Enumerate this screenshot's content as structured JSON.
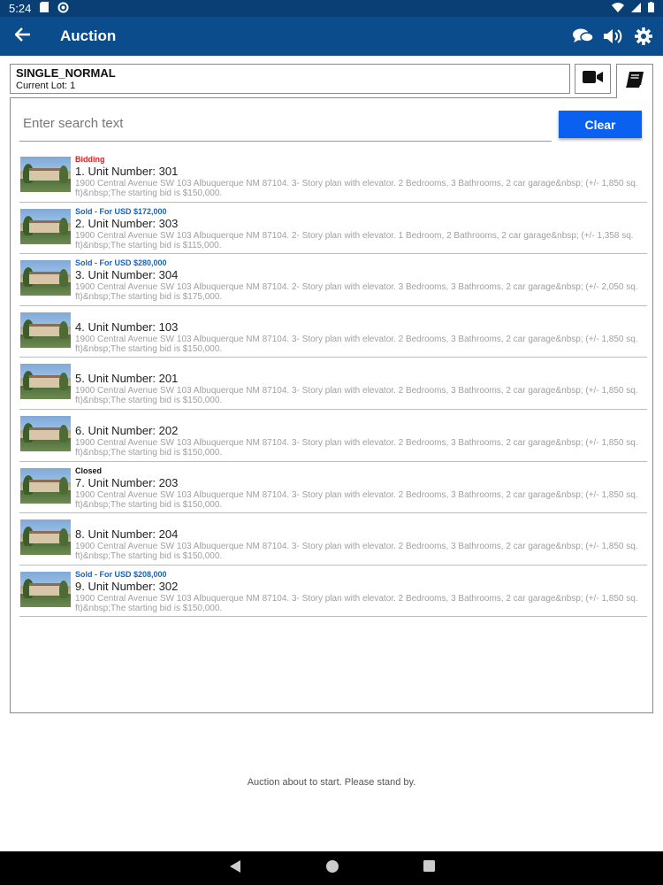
{
  "status_bar": {
    "time": "5:24"
  },
  "appbar": {
    "title": "Auction"
  },
  "lot": {
    "name": "SINGLE_NORMAL",
    "current": "Current Lot: 1"
  },
  "search": {
    "placeholder": "Enter search text",
    "clear_label": "Clear"
  },
  "items": [
    {
      "status": "Bidding",
      "status_color": "#e02020",
      "unit": "1. Unit Number: 301",
      "desc": "1900 Central Avenue SW 103 Albuquerque NM 87104. 3- Story plan with elevator. 2 Bedrooms, 3 Bathrooms, 2 car garage&nbsp; (+/- 1,850 sq. ft)&nbsp;The starting bid is $150,000."
    },
    {
      "status": "Sold - For USD $172,000",
      "status_color": "#1565c0",
      "unit": "2. Unit Number: 303",
      "desc": "1900 Central Avenue SW 103 Albuquerque NM 87104. 2- Story plan with elevator. 1 Bedroom, 2 Bathrooms, 2 car garage&nbsp; (+/- 1,358 sq. ft)&nbsp;The starting bid is $115,000."
    },
    {
      "status": "Sold - For USD $280,000",
      "status_color": "#1565c0",
      "unit": "3. Unit Number: 304",
      "desc": "1900 Central Avenue SW 103 Albuquerque NM 87104. 2- Story plan with elevator. 3 Bedrooms, 3 Bathrooms, 2 car garage&nbsp; (+/- 2,050 sq. ft)&nbsp;The starting bid is $175,000."
    },
    {
      "status": "",
      "status_color": "",
      "unit": "4. Unit Number: 103",
      "desc": "1900 Central Avenue SW 103 Albuquerque NM 87104. 3- Story plan with elevator. 2 Bedrooms, 3 Bathrooms, 2 car garage&nbsp; (+/- 1,850 sq. ft)&nbsp;The starting bid is $150,000."
    },
    {
      "status": "",
      "status_color": "",
      "unit": "5. Unit Number: 201",
      "desc": "1900 Central Avenue SW 103 Albuquerque NM 87104. 3- Story plan with elevator. 2 Bedrooms, 3 Bathrooms, 2 car garage&nbsp; (+/- 1,850 sq. ft)&nbsp;The starting bid is $150,000."
    },
    {
      "status": "",
      "status_color": "",
      "unit": "6. Unit Number: 202",
      "desc": "1900 Central Avenue SW 103 Albuquerque NM 87104. 3- Story plan with elevator. 2 Bedrooms, 3 Bathrooms, 2 car garage&nbsp; (+/- 1,850 sq. ft)&nbsp;The starting bid is $150,000."
    },
    {
      "status": "Closed",
      "status_color": "#111111",
      "unit": "7. Unit Number: 203",
      "desc": "1900 Central Avenue SW 103 Albuquerque NM 87104. 3- Story plan with elevator. 2 Bedrooms, 3 Bathrooms, 2 car garage&nbsp; (+/- 1,850 sq. ft)&nbsp;The starting bid is $150,000."
    },
    {
      "status": "",
      "status_color": "",
      "unit": "8. Unit Number: 204",
      "desc": "1900 Central Avenue SW 103 Albuquerque NM 87104. 3- Story plan with elevator. 2 Bedrooms, 3 Bathrooms, 2 car garage&nbsp; (+/- 1,850 sq. ft)&nbsp;The starting bid is $150,000."
    },
    {
      "status": "Sold - For USD $208,000",
      "status_color": "#1565c0",
      "unit": "9. Unit Number: 302",
      "desc": "1900 Central Avenue SW 103 Albuquerque NM 87104. 3- Story plan with elevator. 2 Bedrooms, 3 Bathrooms, 2 car garage&nbsp; (+/- 1,850 sq. ft)&nbsp;The starting bid is $150,000."
    }
  ],
  "footer": {
    "message": "Auction about to start. Please stand by."
  },
  "colors": {
    "appbar": "#0a4c8c",
    "statusbar": "#0a3f76",
    "clear_button": "#0a61f0"
  },
  "icons": {
    "back": "arrow-left-icon",
    "chat": "chat-icon",
    "volume": "volume-icon",
    "settings": "gear-icon",
    "video": "video-camera-icon",
    "book": "book-icon"
  }
}
